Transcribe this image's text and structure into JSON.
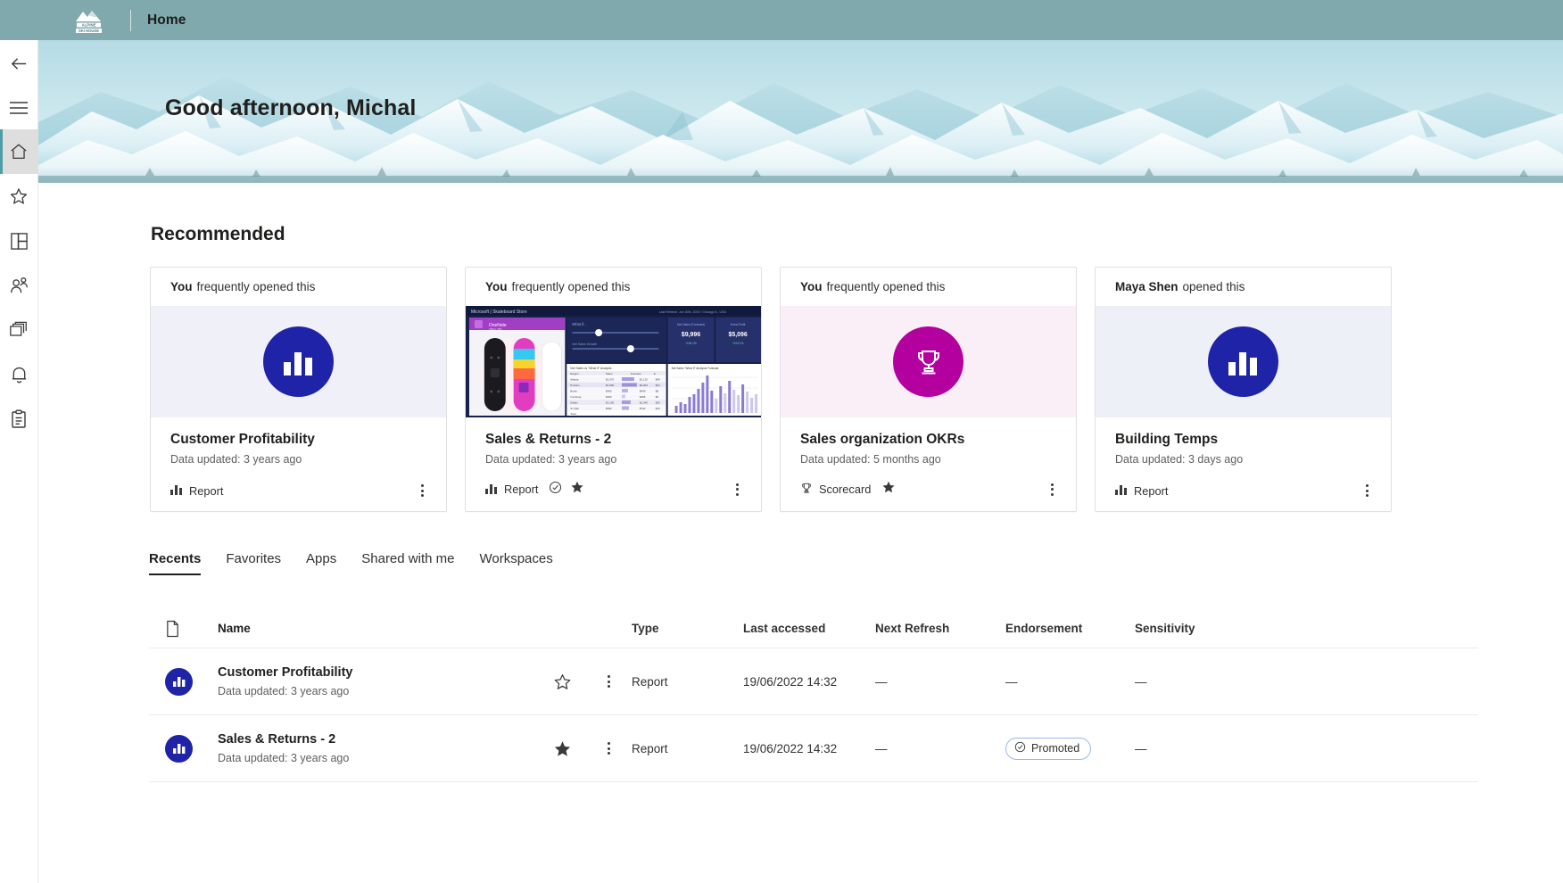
{
  "topbar": {
    "brand_name": "ALPINE SKI HOUSE",
    "brand_line1": "ALPINE",
    "brand_line2": "SKI HOUSE",
    "title": "Home"
  },
  "rail": {
    "items": [
      {
        "name": "back-arrow-icon",
        "label": "Back"
      },
      {
        "name": "hamburger-icon",
        "label": "Navigation menu"
      },
      {
        "name": "home-icon",
        "label": "Home",
        "active": true
      },
      {
        "name": "star-icon",
        "label": "Favorites"
      },
      {
        "name": "apps-icon",
        "label": "Apps"
      },
      {
        "name": "people-icon",
        "label": "Shared with me"
      },
      {
        "name": "workspaces-icon",
        "label": "Workspaces"
      },
      {
        "name": "bell-icon",
        "label": "Notifications"
      },
      {
        "name": "metrics-icon",
        "label": "Metrics"
      }
    ]
  },
  "hero": {
    "greeting": "Good afternoon, Michal"
  },
  "recommended": {
    "title": "Recommended",
    "cards": [
      {
        "actor": "You",
        "reason": "frequently opened this",
        "thumb_kind": "icon-report",
        "name": "Customer Profitability",
        "updated": "Data updated: 3 years ago",
        "type": "Report",
        "type_icon": "bar-chart-icon",
        "certified": false,
        "favorite": false
      },
      {
        "actor": "You",
        "reason": "frequently opened this",
        "thumb_kind": "preview-sales",
        "name": "Sales & Returns  - 2",
        "updated": "Data updated: 3 years ago",
        "type": "Report",
        "type_icon": "bar-chart-icon",
        "certified": true,
        "favorite": true
      },
      {
        "actor": "You",
        "reason": "frequently opened this",
        "thumb_kind": "icon-scorecard",
        "name": "Sales organization OKRs",
        "updated": "Data updated: 5 months ago",
        "type": "Scorecard",
        "type_icon": "trophy-icon",
        "certified": false,
        "favorite": true
      },
      {
        "actor": "Maya Shen",
        "reason": "opened this",
        "thumb_kind": "icon-report",
        "name": "Building Temps",
        "updated": "Data updated: 3 days ago",
        "type": "Report",
        "type_icon": "bar-chart-icon",
        "certified": false,
        "favorite": false
      }
    ]
  },
  "tabs": [
    {
      "label": "Recents",
      "active": true
    },
    {
      "label": "Favorites",
      "active": false
    },
    {
      "label": "Apps",
      "active": false
    },
    {
      "label": "Shared with me",
      "active": false
    },
    {
      "label": "Workspaces",
      "active": false
    }
  ],
  "table": {
    "columns": {
      "icon": "",
      "name": "Name",
      "type": "Type",
      "last_accessed": "Last accessed",
      "next_refresh": "Next Refresh",
      "endorsement": "Endorsement",
      "sensitivity": "Sensitivity"
    },
    "rows": [
      {
        "name": "Customer Profitability",
        "subtitle": "Data updated: 3 years ago",
        "favorite": false,
        "type": "Report",
        "last_accessed": "19/06/2022 14:32",
        "next_refresh": "—",
        "endorsement": "—",
        "endorsement_badge": null,
        "sensitivity": "—"
      },
      {
        "name": "Sales & Returns  - 2",
        "subtitle": "Data updated: 3 years ago",
        "favorite": true,
        "type": "Report",
        "last_accessed": "19/06/2022 14:32",
        "next_refresh": "—",
        "endorsement": "",
        "endorsement_badge": "Promoted",
        "sensitivity": "—"
      }
    ]
  },
  "colors": {
    "topbar": "#7fa9ad",
    "report_blue": "#1f23a8",
    "scorecard_magenta": "#b4009e",
    "active_rail": "#4f9da6",
    "promoted_border": "#9bb8e8"
  }
}
